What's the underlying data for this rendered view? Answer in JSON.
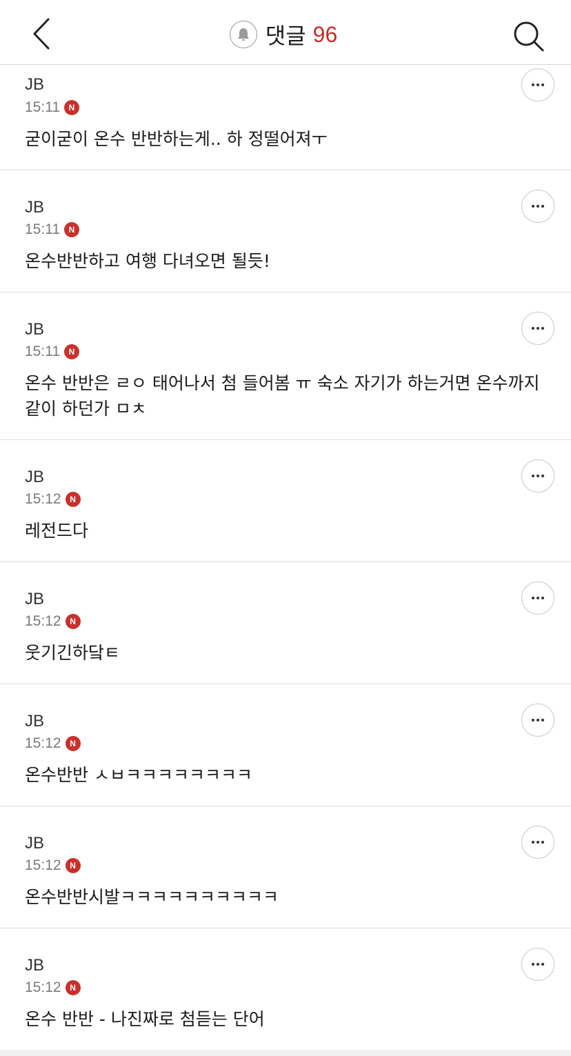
{
  "header": {
    "title": "댓글",
    "count": "96",
    "icons": {
      "back": "chevron-left-icon",
      "bell": "bell-icon",
      "search": "search-icon"
    }
  },
  "badge_label": "N",
  "colors": {
    "accent": "#c0302b",
    "badge": "#c9302c",
    "divider": "#dcdcdc"
  },
  "comments": [
    {
      "author": "JB",
      "time": "15:11",
      "text": "굳이굳이 온수 반반하는게.. 하 정떨어져ㅜ"
    },
    {
      "author": "JB",
      "time": "15:11",
      "text": "온수반반하고 여행 다녀오면 될듯!"
    },
    {
      "author": "JB",
      "time": "15:11",
      "text": "온수 반반은 ㄹㅇ 태어나서 첨 들어봄 ㅠ 숙소 자기가 하는거면 온수까지 같이 하던가 ㅁㅊ"
    },
    {
      "author": "JB",
      "time": "15:12",
      "text": "레전드다"
    },
    {
      "author": "JB",
      "time": "15:12",
      "text": "웃기긴하닼ㅌ"
    },
    {
      "author": "JB",
      "time": "15:12",
      "text": "온수반반 ㅅㅂㅋㅋㅋㅋㅋㅋㅋㅋ"
    },
    {
      "author": "JB",
      "time": "15:12",
      "text": "온수반반시발ㅋㅋㅋㅋㅋㅋㅋㅋㅋㅋ"
    },
    {
      "author": "JB",
      "time": "15:12",
      "text": "온수 반반 - 나진짜로 첨듣는 단어"
    }
  ]
}
